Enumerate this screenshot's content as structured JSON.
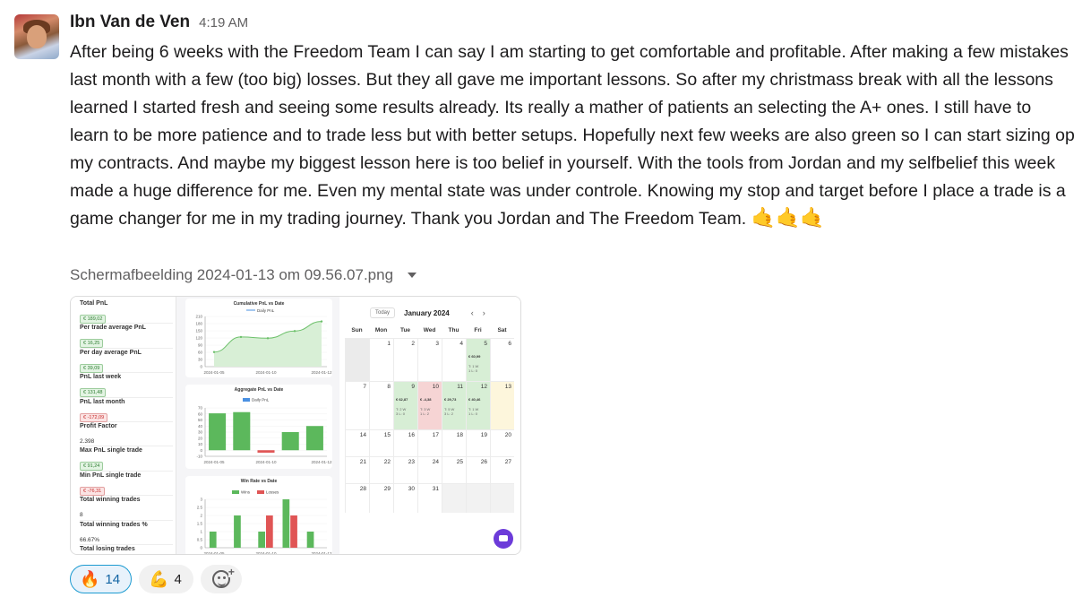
{
  "message": {
    "author": "Ibn Van de Ven",
    "time": "4:19 AM",
    "text": "After being 6 weeks with the Freedom Team I can say I am starting to get comfortable and profitable. After making a few mistakes last month with a few (too big) losses. But they all gave me important lessons. So after my christmass break with all the lessons learned I started fresh and seeing some results already. Its really a mather of patients an selecting the A+ ones. I still have to learn to be more patience and to trade less but with better setups.  Hopefully next few weeks are also green so I can start sizing op my contracts. And maybe my biggest lesson here is too belief in yourself. With the tools from Jordan and my selfbelief this week made a huge difference for me. Even my mental state was under controle. Knowing my stop and target before I place a trade is a game changer for me in my trading journey. Thank you Jordan and The Freedom Team.",
    "emojis": "🤙🤙🤙"
  },
  "attachment": {
    "filename": "Schermafbeelding 2024-01-13 om 09.56.07.png",
    "stats": [
      {
        "label": "Total PnL",
        "value": "€ 189,02",
        "tone": "g"
      },
      {
        "label": "Per trade average PnL",
        "value": "€ 16,25",
        "tone": "g"
      },
      {
        "label": "Per day average PnL",
        "value": "€ 39,09",
        "tone": "g"
      },
      {
        "label": "PnL last week",
        "value": "€ 131,48",
        "tone": "g"
      },
      {
        "label": "PnL last month",
        "value": "€ -172,09",
        "tone": "r"
      },
      {
        "label": "Profit Factor",
        "value": "2.398",
        "tone": "p"
      },
      {
        "label": "Max PnL single trade",
        "value": "€ 91,24",
        "tone": "g"
      },
      {
        "label": "Min PnL single trade",
        "value": "€ -76,31",
        "tone": "r"
      },
      {
        "label": "Total winning trades",
        "value": "8",
        "tone": "p"
      },
      {
        "label": "Total winning trades %",
        "value": "66.67%",
        "tone": "p"
      },
      {
        "label": "Total losing trades",
        "value": "",
        "tone": "p"
      }
    ],
    "charts": {
      "cumulative": {
        "title": "Cumulative PnL vs Date",
        "legend": "Daily PnL",
        "yticks": [
          "210",
          "180",
          "150",
          "120",
          "90",
          "60",
          "30",
          "0"
        ],
        "xticks": [
          "2024-01-05",
          "2024-01-10",
          "2024-01-12"
        ]
      },
      "aggregate": {
        "title": "Aggregate PnL vs Date",
        "legend": "Daily PnL",
        "yticks": [
          "70",
          "60",
          "50",
          "40",
          "30",
          "20",
          "10",
          "0",
          "-10"
        ],
        "xticks": [
          "2024-01-05",
          "2024-01-10",
          "2024-01-12"
        ]
      },
      "winrate": {
        "title": "Win Rate vs Date",
        "legend_wins": "Wins",
        "legend_losses": "Losses",
        "yticks": [
          "3",
          "2.5",
          "2",
          "1.5",
          "1",
          "0.5",
          "0"
        ],
        "xticks": [
          "2024-01-05",
          "2024-01-10",
          "2024-01-12"
        ]
      }
    },
    "calendar": {
      "today_label": "Today",
      "month": "January 2024",
      "prev": "‹",
      "next": "›",
      "days_of_week": [
        "Sun",
        "Mon",
        "Tue",
        "Wed",
        "Thu",
        "Fri",
        "Sat"
      ],
      "weeks": [
        [
          "",
          "1",
          "2",
          "3",
          "4",
          "5",
          "6"
        ],
        [
          "7",
          "8",
          "9",
          "10",
          "11",
          "12",
          "13"
        ],
        [
          "14",
          "15",
          "16",
          "17",
          "18",
          "19",
          "20"
        ],
        [
          "21",
          "22",
          "23",
          "24",
          "25",
          "26",
          "27"
        ],
        [
          "28",
          "29",
          "30",
          "31",
          "",
          "",
          ""
        ]
      ],
      "entries": {
        "5": {
          "amount": "€ 60,99",
          "wl": "T: 1 W\n1 L: 0",
          "tone": "g"
        },
        "9": {
          "amount": "€ 62,87",
          "wl": "T: 2 W\n3 L: 0",
          "tone": "g"
        },
        "10": {
          "amount": "€ -4,38",
          "wl": "T: 3 W\n1 L: 2",
          "tone": "r"
        },
        "11": {
          "amount": "€ 29,73",
          "wl": "T: 5 W\n3 L: 2",
          "tone": "g"
        },
        "12": {
          "amount": "€ 40,46",
          "wl": "T: 1 W\n1 L: 0",
          "tone": "g"
        }
      }
    }
  },
  "chart_data": [
    {
      "type": "area",
      "title": "Cumulative PnL vs Date",
      "series": [
        {
          "name": "Daily PnL",
          "x": [
            "2024-01-05",
            "2024-01-09",
            "2024-01-10",
            "2024-01-11",
            "2024-01-12"
          ],
          "values": [
            61,
            124,
            119,
            149,
            189
          ]
        }
      ],
      "ylim": [
        0,
        210
      ]
    },
    {
      "type": "bar",
      "title": "Aggregate PnL vs Date",
      "categories": [
        "2024-01-05",
        "2024-01-09",
        "2024-01-10",
        "2024-01-11",
        "2024-01-12"
      ],
      "series": [
        {
          "name": "Daily PnL",
          "values": [
            61,
            63,
            -4,
            30,
            40
          ]
        }
      ],
      "ylim": [
        -10,
        70
      ]
    },
    {
      "type": "bar",
      "title": "Win Rate vs Date",
      "categories": [
        "2024-01-05",
        "2024-01-09",
        "2024-01-10",
        "2024-01-11",
        "2024-01-12"
      ],
      "series": [
        {
          "name": "Wins",
          "values": [
            1,
            2,
            1,
            3,
            1
          ]
        },
        {
          "name": "Losses",
          "values": [
            0,
            0,
            2,
            2,
            0
          ]
        }
      ],
      "ylim": [
        0,
        3
      ]
    }
  ],
  "reactions": [
    {
      "emoji": "🔥",
      "count": "14",
      "active": true
    },
    {
      "emoji": "💪",
      "count": "4",
      "active": false
    }
  ],
  "colors": {
    "green": "#5cb85c",
    "red": "#e05555",
    "mention_blue": "#1d9bd1"
  }
}
